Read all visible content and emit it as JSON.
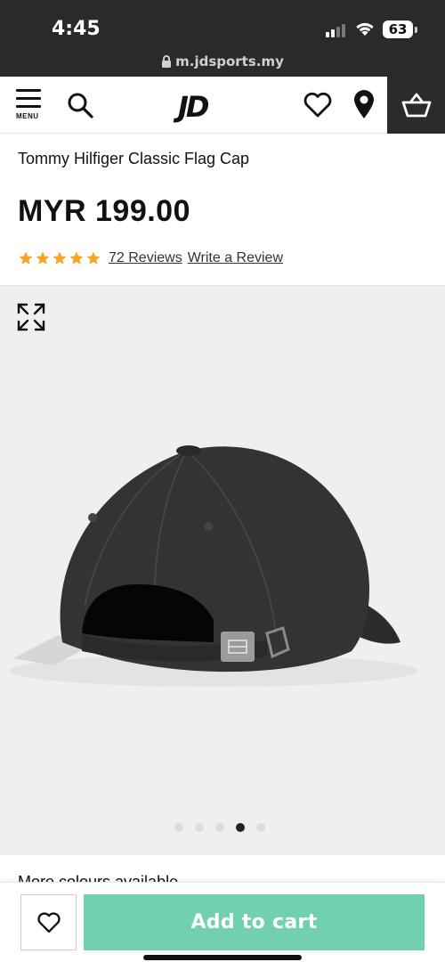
{
  "status_bar": {
    "time": "4:45",
    "battery": "63",
    "url": "m.jdsports.my"
  },
  "header": {
    "menu_label": "MENU",
    "logo": "JD",
    "icons": [
      "menu-icon",
      "search-icon",
      "heart-icon",
      "location-pin-icon",
      "basket-icon"
    ]
  },
  "product": {
    "title": "Tommy Hilfiger Classic Flag Cap",
    "price": "MYR 199.00",
    "rating": 5,
    "rating_max": 5,
    "reviews_link": "72 Reviews",
    "write_review_link": "Write a Review",
    "star_color": "#f5a623"
  },
  "gallery": {
    "image_count": 5,
    "active_index": 3,
    "expand_icon": "expand-icon"
  },
  "more_colours": {
    "label": "More colours available"
  },
  "actions": {
    "add_to_cart": "Add to cart",
    "accent": "#71d0b0"
  }
}
